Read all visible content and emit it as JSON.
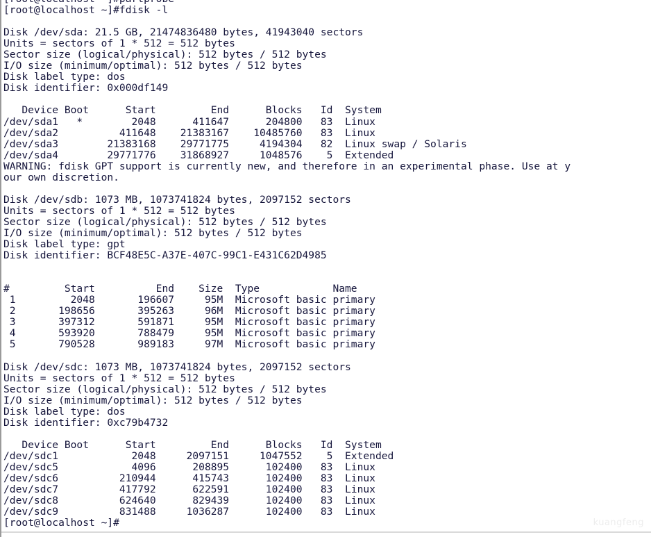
{
  "terminal": {
    "window_title": "fdisk -l",
    "prompt": "[root@localhost ~]#",
    "text_color": "#16163c",
    "background_color": "#ffffff",
    "border_color": "#9a9a9a",
    "watermark": "kuangfeng",
    "lines": [
      "[root@localhost ~]#partprobe",
      "[root@localhost ~]#fdisk -l",
      "",
      "Disk /dev/sda: 21.5 GB, 21474836480 bytes, 41943040 sectors",
      "Units = sectors of 1 * 512 = 512 bytes",
      "Sector size (logical/physical): 512 bytes / 512 bytes",
      "I/O size (minimum/optimal): 512 bytes / 512 bytes",
      "Disk label type: dos",
      "Disk identifier: 0x000df149",
      "",
      "   Device Boot      Start         End      Blocks   Id  System",
      "/dev/sda1   *        2048      411647      204800   83  Linux",
      "/dev/sda2          411648    21383167    10485760   83  Linux",
      "/dev/sda3        21383168    29771775     4194304   82  Linux swap / Solaris",
      "/dev/sda4        29771776    31868927     1048576    5  Extended",
      "WARNING: fdisk GPT support is currently new, and therefore in an experimental phase. Use at y",
      "our own discretion.",
      "",
      "Disk /dev/sdb: 1073 MB, 1073741824 bytes, 2097152 sectors",
      "Units = sectors of 1 * 512 = 512 bytes",
      "Sector size (logical/physical): 512 bytes / 512 bytes",
      "I/O size (minimum/optimal): 512 bytes / 512 bytes",
      "Disk label type: gpt",
      "Disk identifier: BCF48E5C-A37E-407C-99C1-E431C62D4985",
      "",
      "",
      "#         Start          End    Size  Type            Name",
      " 1         2048       196607     95M  Microsoft basic primary",
      " 2       198656       395263     96M  Microsoft basic primary",
      " 3       397312       591871     95M  Microsoft basic primary",
      " 4       593920       788479     95M  Microsoft basic primary",
      " 5       790528       989183     97M  Microsoft basic primary",
      "",
      "Disk /dev/sdc: 1073 MB, 1073741824 bytes, 2097152 sectors",
      "Units = sectors of 1 * 512 = 512 bytes",
      "Sector size (logical/physical): 512 bytes / 512 bytes",
      "I/O size (minimum/optimal): 512 bytes / 512 bytes",
      "Disk label type: dos",
      "Disk identifier: 0xc79b4732",
      "",
      "   Device Boot      Start         End      Blocks   Id  System",
      "/dev/sdc1            2048     2097151     1047552    5  Extended",
      "/dev/sdc5            4096      208895      102400   83  Linux",
      "/dev/sdc6          210944      415743      102400   83  Linux",
      "/dev/sdc7          417792      622591      102400   83  Linux",
      "/dev/sdc8          624640      829439      102400   83  Linux",
      "/dev/sdc9          831488     1036287      102400   83  Linux",
      "[root@localhost ~]#"
    ]
  },
  "disks": [
    {
      "device": "/dev/sda",
      "size_human": "21.5 GB",
      "size_bytes": "21474836480",
      "sectors": "41943040",
      "units": "sectors of 1 * 512 = 512 bytes",
      "sector_size": "512 bytes / 512 bytes",
      "io_size": "512 bytes / 512 bytes",
      "label_type": "dos",
      "identifier": "0x000df149",
      "table_headers": [
        "Device",
        "Boot",
        "Start",
        "End",
        "Blocks",
        "Id",
        "System"
      ],
      "partitions": [
        {
          "device": "/dev/sda1",
          "boot": "*",
          "start": "2048",
          "end": "411647",
          "blocks": "204800",
          "id": "83",
          "system": "Linux"
        },
        {
          "device": "/dev/sda2",
          "boot": "",
          "start": "411648",
          "end": "21383167",
          "blocks": "10485760",
          "id": "83",
          "system": "Linux"
        },
        {
          "device": "/dev/sda3",
          "boot": "",
          "start": "21383168",
          "end": "29771775",
          "blocks": "4194304",
          "id": "82",
          "system": "Linux swap / Solaris"
        },
        {
          "device": "/dev/sda4",
          "boot": "",
          "start": "29771776",
          "end": "31868927",
          "blocks": "1048576",
          "id": "5",
          "system": "Extended"
        }
      ],
      "warning": "WARNING: fdisk GPT support is currently new, and therefore in an experimental phase. Use at your own discretion."
    },
    {
      "device": "/dev/sdb",
      "size_human": "1073 MB",
      "size_bytes": "1073741824",
      "sectors": "2097152",
      "units": "sectors of 1 * 512 = 512 bytes",
      "sector_size": "512 bytes / 512 bytes",
      "io_size": "512 bytes / 512 bytes",
      "label_type": "gpt",
      "identifier": "BCF48E5C-A37E-407C-99C1-E431C62D4985",
      "table_headers": [
        "#",
        "Start",
        "End",
        "Size",
        "Type",
        "Name"
      ],
      "partitions": [
        {
          "number": "1",
          "start": "2048",
          "end": "196607",
          "size": "95M",
          "type": "Microsoft basic",
          "name": "primary"
        },
        {
          "number": "2",
          "start": "198656",
          "end": "395263",
          "size": "96M",
          "type": "Microsoft basic",
          "name": "primary"
        },
        {
          "number": "3",
          "start": "397312",
          "end": "591871",
          "size": "95M",
          "type": "Microsoft basic",
          "name": "primary"
        },
        {
          "number": "4",
          "start": "593920",
          "end": "788479",
          "size": "95M",
          "type": "Microsoft basic",
          "name": "primary"
        },
        {
          "number": "5",
          "start": "790528",
          "end": "989183",
          "size": "97M",
          "type": "Microsoft basic",
          "name": "primary"
        }
      ]
    },
    {
      "device": "/dev/sdc",
      "size_human": "1073 MB",
      "size_bytes": "1073741824",
      "sectors": "2097152",
      "units": "sectors of 1 * 512 = 512 bytes",
      "sector_size": "512 bytes / 512 bytes",
      "io_size": "512 bytes / 512 bytes",
      "label_type": "dos",
      "identifier": "0xc79b4732",
      "table_headers": [
        "Device",
        "Boot",
        "Start",
        "End",
        "Blocks",
        "Id",
        "System"
      ],
      "partitions": [
        {
          "device": "/dev/sdc1",
          "boot": "",
          "start": "2048",
          "end": "2097151",
          "blocks": "1047552",
          "id": "5",
          "system": "Extended"
        },
        {
          "device": "/dev/sdc5",
          "boot": "",
          "start": "4096",
          "end": "208895",
          "blocks": "102400",
          "id": "83",
          "system": "Linux"
        },
        {
          "device": "/dev/sdc6",
          "boot": "",
          "start": "210944",
          "end": "415743",
          "blocks": "102400",
          "id": "83",
          "system": "Linux"
        },
        {
          "device": "/dev/sdc7",
          "boot": "",
          "start": "417792",
          "end": "622591",
          "blocks": "102400",
          "id": "83",
          "system": "Linux"
        },
        {
          "device": "/dev/sdc8",
          "boot": "",
          "start": "624640",
          "end": "829439",
          "blocks": "102400",
          "id": "83",
          "system": "Linux"
        },
        {
          "device": "/dev/sdc9",
          "boot": "",
          "start": "831488",
          "end": "1036287",
          "blocks": "102400",
          "id": "83",
          "system": "Linux"
        }
      ]
    }
  ]
}
